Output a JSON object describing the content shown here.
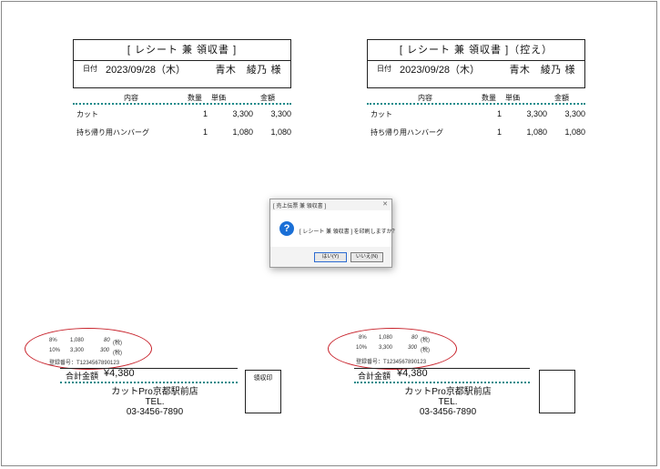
{
  "left": {
    "title": "[ レシート 兼 領収書 ]",
    "date_label": "日付",
    "date": "2023/09/28（木）",
    "customer": "青木　綾乃 様",
    "headers": {
      "desc": "内容",
      "qty": "数量",
      "price": "単価",
      "amount": "金額"
    },
    "items": [
      {
        "name": "カット",
        "qty": "1",
        "price": "3,300",
        "amount": "3,300"
      },
      {
        "name": "持ち帰り用ハンバーグ",
        "qty": "1",
        "price": "1,080",
        "amount": "1,080"
      }
    ],
    "tax_rows": [
      {
        "rate": "8%",
        "base": "1,080",
        "tax": "80",
        "note": "(税)"
      },
      {
        "rate": "10%",
        "base": "3,300",
        "tax": "300",
        "note": "(税)"
      }
    ],
    "registration": "登録番号：T1234567890123",
    "total_label": "合計金額",
    "total_value": "¥4,380",
    "shop_name": "カットPro京都駅前店",
    "tel_label": "TEL.",
    "tel": "03-3456-7890",
    "stamp_label": "領収印"
  },
  "right": {
    "title": "[ レシート 兼 領収書 ]（控え）",
    "date_label": "日付",
    "date": "2023/09/28（木）",
    "customer": "青木　綾乃 様",
    "headers": {
      "desc": "内容",
      "qty": "数量",
      "price": "単価",
      "amount": "金額"
    },
    "items": [
      {
        "name": "カット",
        "qty": "1",
        "price": "3,300",
        "amount": "3,300"
      },
      {
        "name": "持ち帰り用ハンバーグ",
        "qty": "1",
        "price": "1,080",
        "amount": "1,080"
      }
    ],
    "tax_rows": [
      {
        "rate": "8%",
        "base": "1,080",
        "tax": "80",
        "note": "(税)"
      },
      {
        "rate": "10%",
        "base": "3,300",
        "tax": "300",
        "note": "(税)"
      }
    ],
    "registration": "登録番号：T1234567890123",
    "total_label": "合計金額",
    "total_value": "¥4,380",
    "shop_name": "カットPro京都駅前店",
    "tel_label": "TEL.",
    "tel": "03-3456-7890",
    "stamp_label": ""
  },
  "dialog": {
    "title": "[ 売上伝票 兼 領収書 ]",
    "message": "[ レシート 兼 領収書 ] を印刷しますか？",
    "icon": "question-icon",
    "yes_label": "はい(Y)",
    "no_label": "いいえ(N)"
  },
  "colors": {
    "highlight_ellipse": "#c8232c",
    "dotted_rule": "#1a8a8a",
    "dialog_icon": "#1a6fd6"
  }
}
